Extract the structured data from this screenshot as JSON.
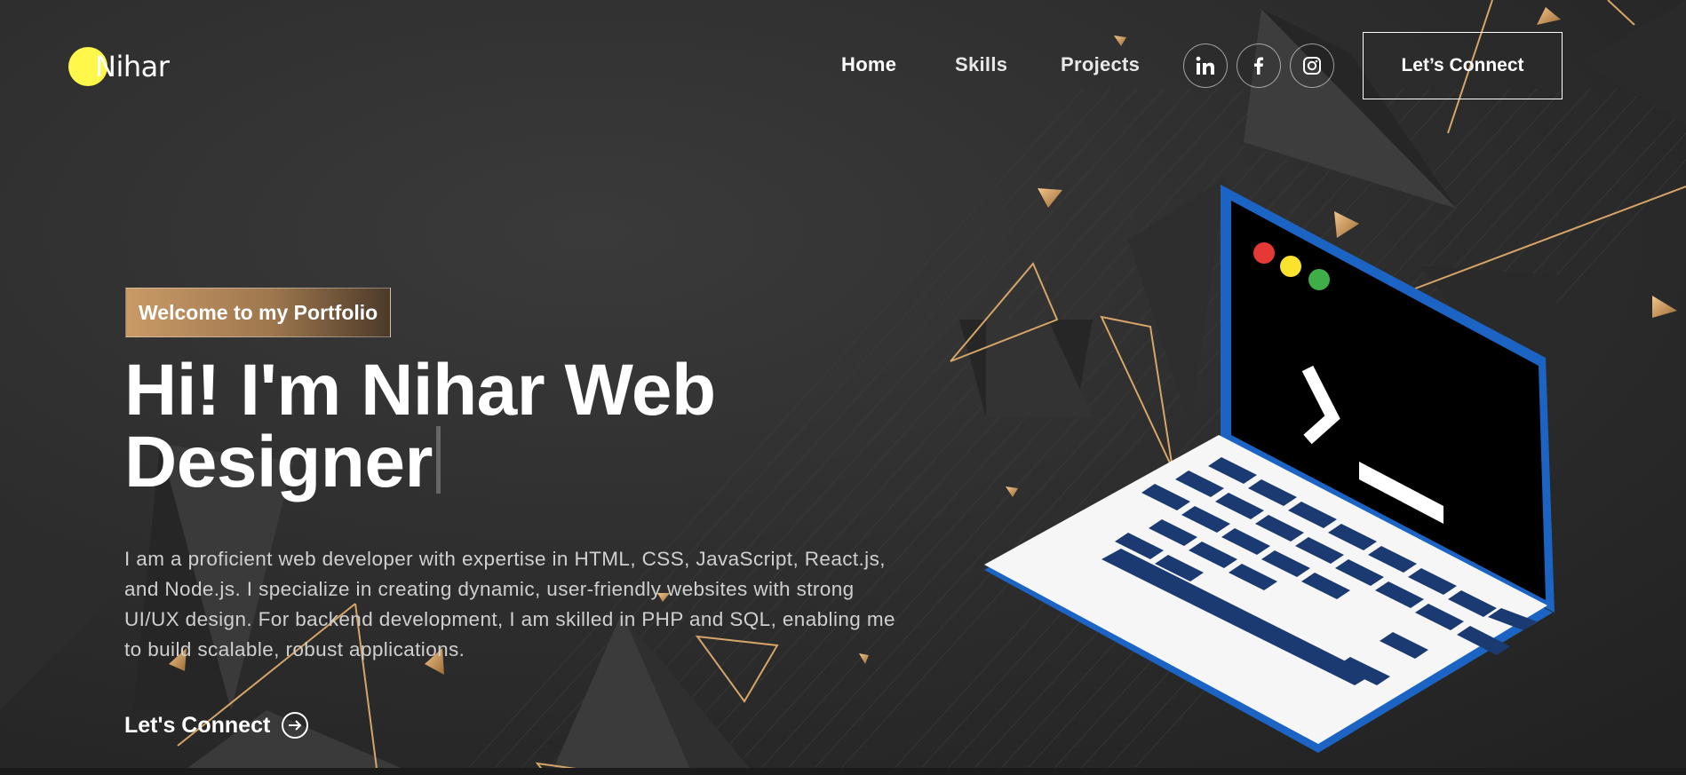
{
  "brand": {
    "name": "Nihar",
    "accent": "#fff84a"
  },
  "nav": {
    "links": [
      {
        "label": "Home"
      },
      {
        "label": "Skills"
      },
      {
        "label": "Projects"
      }
    ],
    "social": [
      {
        "icon": "linkedin-icon"
      },
      {
        "icon": "facebook-icon"
      },
      {
        "icon": "instagram-icon"
      }
    ],
    "connect_label": "Let’s Connect"
  },
  "hero": {
    "tagline": "Welcome to my Portfolio",
    "headline": "Hi! I'm Nihar Web Designer",
    "description": "I am a proficient web developer with expertise in HTML, CSS, JavaScript, React.js, and Node.js. I specialize in creating dynamic, user-friendly websites with strong UI/UX design. For backend development, I am skilled in PHP and SQL, enabling me to build scalable, robust applications.",
    "cta_label": "Let's Connect"
  },
  "colors": {
    "background": "#2b2b2b",
    "gold": "#d9a86a",
    "laptop_frame": "#1c64c4",
    "key_blue": "#1c3a72",
    "dot_red": "#e53935",
    "dot_yellow": "#fbe32d",
    "dot_green": "#3fae49"
  }
}
